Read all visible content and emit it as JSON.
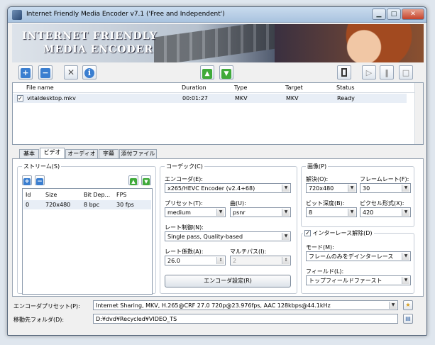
{
  "window": {
    "title": "Internet Friendly Media Encoder v7.1 ('Free and Independent')",
    "banner_line1": "INTERNET FRIENDLY",
    "banner_line2": "MEDIA ENCODER"
  },
  "toolbar": {
    "add_icon": "plus-icon",
    "remove_icon": "minus-icon",
    "settings_icon": "tools-icon",
    "info_icon": "info-icon",
    "move_up_icon": "arrow-up-icon",
    "move_down_icon": "arrow-down-icon",
    "preview_icon": "preview-icon",
    "play_icon": "play-icon",
    "pause_icon": "pause-icon",
    "stop_icon": "stop-icon"
  },
  "file_list": {
    "columns": [
      "File name",
      "Duration",
      "Type",
      "Target",
      "Status"
    ],
    "rows": [
      {
        "checked": true,
        "file_name": "vitaldesktop.mkv",
        "duration": "00:01:27",
        "type": "MKV",
        "target": "MKV",
        "status": "Ready"
      }
    ]
  },
  "tabs": [
    "基本",
    "ビデオ",
    "オーディオ",
    "字幕",
    "添付ファイル"
  ],
  "active_tab": "ビデオ",
  "streams": {
    "title": "ストリーム(S)",
    "columns": [
      "Id",
      "Size",
      "Bit Dep...",
      "FPS"
    ],
    "rows": [
      {
        "id": "0",
        "size": "720x480",
        "bit_depth": "8 bpc",
        "fps": "30 fps"
      }
    ]
  },
  "codec": {
    "title": "コーデック(C)",
    "encoder_label": "エンコーダ(E):",
    "encoder_value": "x265/HEVC Encoder (v2.4+68)",
    "preset_label": "プリセット(T):",
    "preset_value": "medium",
    "tune_label": "曲(U):",
    "tune_value": "psnr",
    "rate_control_label": "レート制御(N):",
    "rate_control_value": "Single pass, Quality-based",
    "rate_factor_label": "レート係数(A):",
    "rate_factor_value": "26.0",
    "multipass_label": "マルチパス(I):",
    "multipass_value": "2",
    "encoder_settings_button": "エンコーダ設定(R)"
  },
  "image": {
    "title": "画像(P)",
    "resolution_label": "解決(O):",
    "resolution_value": "720x480",
    "framerate_label": "フレームレート(F):",
    "framerate_value": "30",
    "bit_depth_label": "ビット深度(B):",
    "bit_depth_value": "8",
    "pixel_format_label": "ピクセル形式(X):",
    "pixel_format_value": "420"
  },
  "deinterlace": {
    "checked": true,
    "title": "インターレース解除(D)",
    "mode_label": "モード(M):",
    "mode_value": "フレームのみをデインターレース",
    "field_label": "フィールド(L):",
    "field_value": "トップフィールドファースト"
  },
  "bottom": {
    "encoder_preset_label": "エンコーダプリセット(P):",
    "encoder_preset_value": "Internet Sharing, MKV, H.265@CRF 27.0 720p@23.976fps, AAC 128kbps@44.1kHz",
    "destination_label": "移動先フォルダ(D):",
    "destination_value": "D:¥dvd¥Recycled¥VIDEO_TS"
  }
}
